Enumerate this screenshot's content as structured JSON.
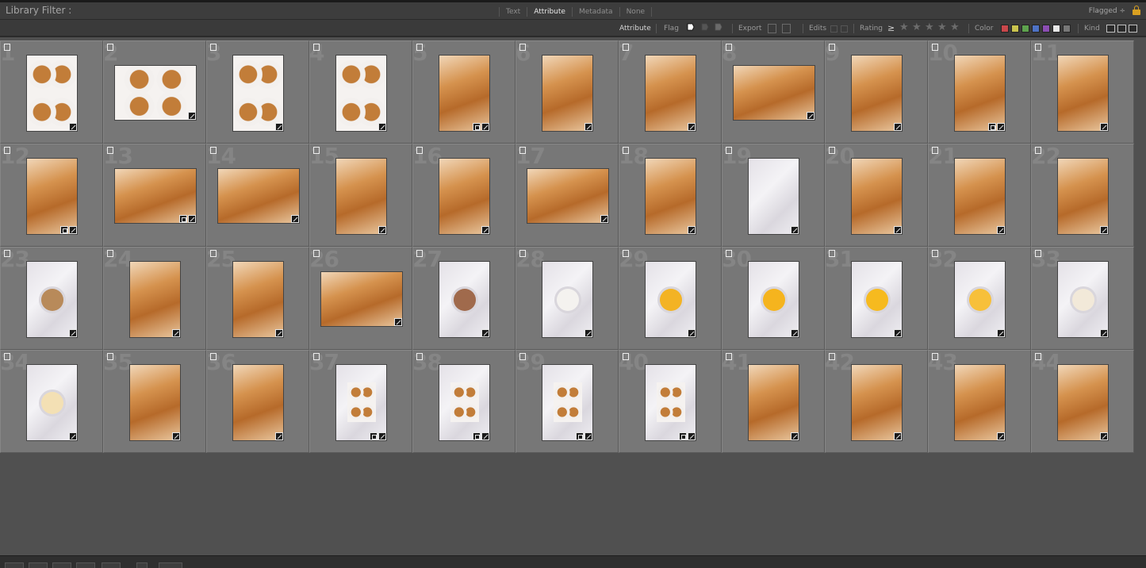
{
  "filter_bar": {
    "title": "Library Filter :",
    "tabs": [
      {
        "label": "Text",
        "active": false
      },
      {
        "label": "Attribute",
        "active": true
      },
      {
        "label": "Metadata",
        "active": false
      },
      {
        "label": "None",
        "active": false
      }
    ],
    "preset": "Flagged ÷"
  },
  "attribute_bar": {
    "attribute_label": "Attribute",
    "flag_label": "Flag",
    "export_label": "Export",
    "edits_label": "Edits",
    "rating_label": "Rating",
    "rating_op": "≥",
    "color_label": "Color",
    "kind_label": "Kind",
    "color_swatches": [
      "#c8474b",
      "#c9c34e",
      "#5ea24e",
      "#4e72c4",
      "#8b4eb3",
      "#e8e8e8",
      "#777777"
    ]
  },
  "grid": {
    "cells": [
      {
        "n": "1",
        "type": "portrait",
        "style": "pan"
      },
      {
        "n": "2",
        "type": "landscape",
        "style": "pan"
      },
      {
        "n": "3",
        "type": "portrait",
        "style": "pan"
      },
      {
        "n": "4",
        "type": "portrait",
        "style": "pan"
      },
      {
        "n": "5",
        "type": "portrait",
        "style": "warm",
        "sq": true
      },
      {
        "n": "6",
        "type": "portrait",
        "style": "warm"
      },
      {
        "n": "7",
        "type": "portrait",
        "style": "warm"
      },
      {
        "n": "8",
        "type": "landscape",
        "style": "warm"
      },
      {
        "n": "9",
        "type": "portrait",
        "style": "warm"
      },
      {
        "n": "10",
        "type": "portrait",
        "style": "warm",
        "sq": true
      },
      {
        "n": "11",
        "type": "portrait",
        "style": "warm"
      },
      {
        "n": "12",
        "type": "portrait",
        "style": "warm",
        "sq": true
      },
      {
        "n": "13",
        "type": "landscape",
        "style": "warm",
        "sq": true
      },
      {
        "n": "14",
        "type": "landscape",
        "style": "warm"
      },
      {
        "n": "15",
        "type": "portrait",
        "style": "warm"
      },
      {
        "n": "16",
        "type": "portrait",
        "style": "warm"
      },
      {
        "n": "17",
        "type": "landscape",
        "style": "warm"
      },
      {
        "n": "18",
        "type": "portrait",
        "style": "warm"
      },
      {
        "n": "19",
        "type": "portrait",
        "style": "marble"
      },
      {
        "n": "20",
        "type": "portrait",
        "style": "warm"
      },
      {
        "n": "21",
        "type": "portrait",
        "style": "warm"
      },
      {
        "n": "22",
        "type": "portrait",
        "style": "warm"
      },
      {
        "n": "23",
        "type": "portrait",
        "style": "marble",
        "bowl": "#b88a5a"
      },
      {
        "n": "24",
        "type": "portrait",
        "style": "warm"
      },
      {
        "n": "25",
        "type": "portrait",
        "style": "warm"
      },
      {
        "n": "26",
        "type": "landscape",
        "style": "warm"
      },
      {
        "n": "27",
        "type": "portrait",
        "style": "marble",
        "bowl": "#a06a4c"
      },
      {
        "n": "28",
        "type": "portrait",
        "style": "marble",
        "bowl": "#f4f2ef"
      },
      {
        "n": "29",
        "type": "portrait",
        "style": "marble",
        "bowl": "#f3b324"
      },
      {
        "n": "30",
        "type": "portrait",
        "style": "marble",
        "bowl": "#f5b41e"
      },
      {
        "n": "31",
        "type": "portrait",
        "style": "marble",
        "bowl": "#f6ba1f"
      },
      {
        "n": "32",
        "type": "portrait",
        "style": "marble",
        "bowl": "#f7c03a"
      },
      {
        "n": "33",
        "type": "portrait",
        "style": "marble",
        "bowl": "#f2e9d9"
      },
      {
        "n": "34",
        "type": "portrait",
        "style": "marble",
        "bowl": "#f3e0b4"
      },
      {
        "n": "35",
        "type": "portrait",
        "style": "warm"
      },
      {
        "n": "36",
        "type": "portrait",
        "style": "warm"
      },
      {
        "n": "37",
        "type": "portrait",
        "style": "marble",
        "sq": true,
        "pan": true
      },
      {
        "n": "38",
        "type": "portrait",
        "style": "marble",
        "sq": true,
        "pan": true
      },
      {
        "n": "39",
        "type": "portrait",
        "style": "marble",
        "sq": true,
        "pan": true
      },
      {
        "n": "40",
        "type": "portrait",
        "style": "marble",
        "sq": true,
        "pan": true
      },
      {
        "n": "41",
        "type": "portrait",
        "style": "warm"
      },
      {
        "n": "42",
        "type": "portrait",
        "style": "warm"
      },
      {
        "n": "43",
        "type": "portrait",
        "style": "warm"
      },
      {
        "n": "44",
        "type": "portrait",
        "style": "warm"
      }
    ]
  }
}
